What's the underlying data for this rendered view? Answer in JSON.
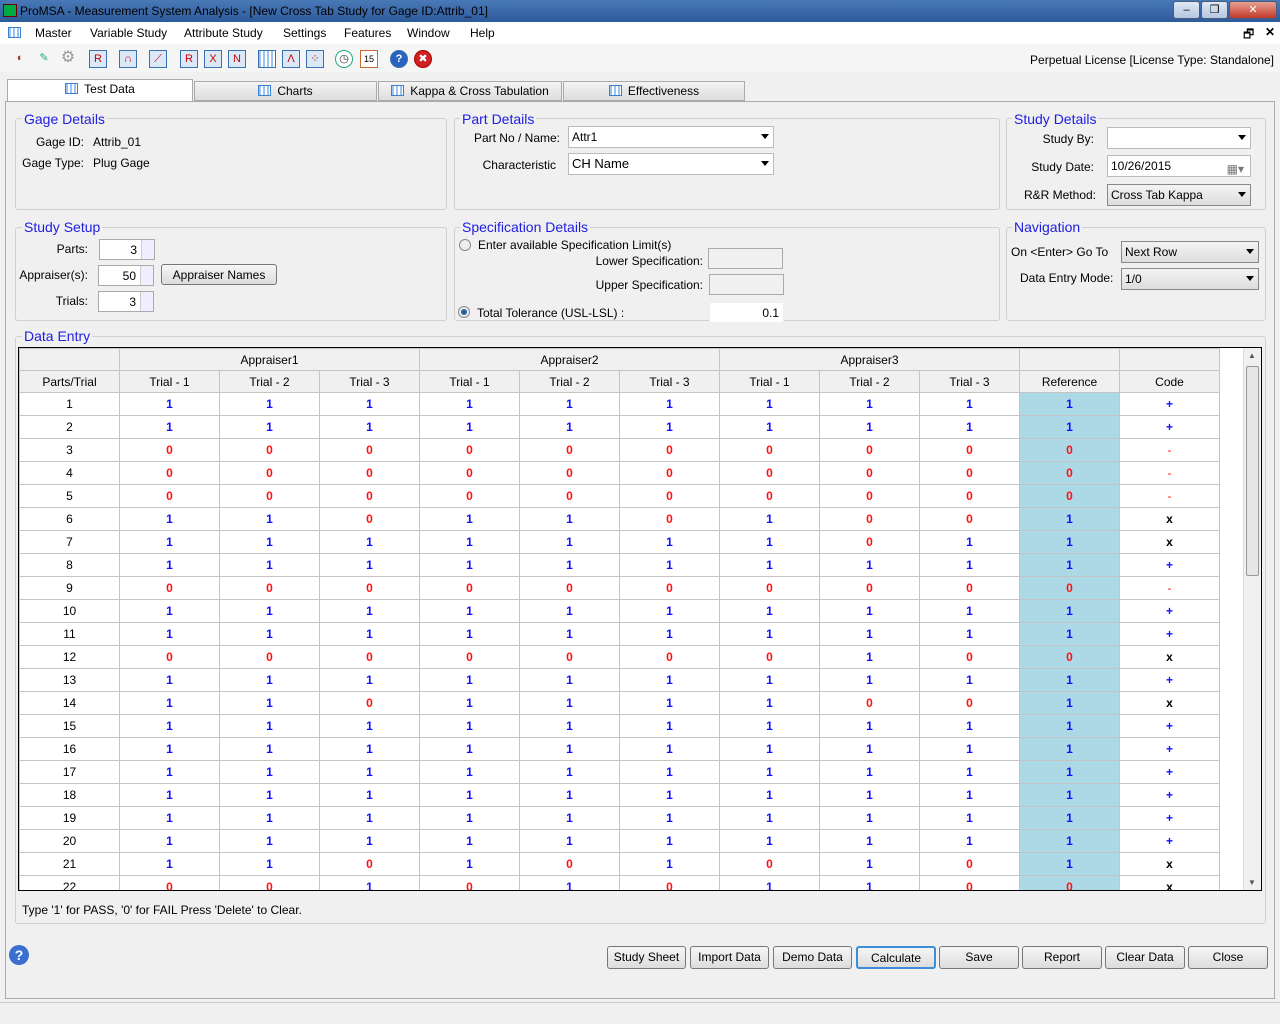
{
  "window": {
    "title": "ProMSA - Measurement System Analysis  - [New Cross Tab Study for Gage ID:Attrib_01]",
    "controls": [
      "minimize",
      "restore",
      "close"
    ]
  },
  "menu": [
    "Master",
    "Variable Study",
    "Attribute Study",
    "Settings",
    "Features",
    "Window",
    "Help"
  ],
  "toolbar": {
    "icons": [
      "paint-brush-icon",
      "pencil-icon",
      "gear-icon",
      "control-chart-r-icon",
      "normal-curve-icon",
      "linearity-icon",
      "chart-r-icon",
      "chart-x-icon",
      "chart-n-icon",
      "grid-icon",
      "distribution-icon",
      "scatter-icon",
      "clock-icon",
      "calendar-icon",
      "help-icon",
      "close-icon"
    ],
    "calendar_label": "15",
    "help_label": "?",
    "close_label": "✖"
  },
  "license": "Perpetual License [License Type: Standalone]",
  "tabs": [
    "Test Data",
    "Charts",
    "Kappa & Cross Tabulation",
    "Effectiveness"
  ],
  "gage": {
    "title": "Gage Details",
    "id_label": "Gage ID:",
    "id": "Attrib_01",
    "type_label": "Gage Type:",
    "type": "Plug Gage"
  },
  "part": {
    "title": "Part Details",
    "name_label": "Part No / Name:",
    "name": "Attr1",
    "char_label": "Characteristic",
    "char": "CH Name"
  },
  "study": {
    "title": "Study Details",
    "by_label": "Study By:",
    "by": "",
    "date_label": "Study Date:",
    "date": "10/26/2015",
    "method_label": "R&R Method:",
    "method": "Cross Tab Kappa"
  },
  "setup": {
    "title": "Study Setup",
    "parts_label": "Parts:",
    "parts": "3",
    "appr_label": "Appraiser(s):",
    "appr": "50",
    "trials_label": "Trials:",
    "trials": "3",
    "names_button": "Appraiser Names"
  },
  "spec": {
    "title": "Specification Details",
    "opt1": "Enter available Specification Limit(s)",
    "lower_label": "Lower Specification:",
    "lower": "",
    "upper_label": "Upper Specification:",
    "upper": "",
    "opt2": "Total Tolerance (USL-LSL) :",
    "tolerance": "0.1",
    "selected": "tolerance"
  },
  "nav": {
    "title": "Navigation",
    "enter_label": "On <Enter> Go To",
    "enter": "Next Row",
    "mode_label": "Data Entry Mode:",
    "mode": "1/0"
  },
  "data_entry": {
    "title": "Data Entry",
    "appraisers": [
      "Appraiser1",
      "Appraiser2",
      "Appraiser3"
    ],
    "columns": [
      "Parts/Trial",
      "Trial - 1",
      "Trial - 2",
      "Trial - 3",
      "Trial - 1",
      "Trial - 2",
      "Trial - 3",
      "Trial - 1",
      "Trial - 2",
      "Trial - 3",
      "Reference",
      "Code"
    ],
    "rows": [
      [
        "1",
        1,
        1,
        1,
        1,
        1,
        1,
        1,
        1,
        1,
        1,
        "+"
      ],
      [
        "2",
        1,
        1,
        1,
        1,
        1,
        1,
        1,
        1,
        1,
        1,
        "+"
      ],
      [
        "3",
        0,
        0,
        0,
        0,
        0,
        0,
        0,
        0,
        0,
        0,
        "-"
      ],
      [
        "4",
        0,
        0,
        0,
        0,
        0,
        0,
        0,
        0,
        0,
        0,
        "-"
      ],
      [
        "5",
        0,
        0,
        0,
        0,
        0,
        0,
        0,
        0,
        0,
        0,
        "-"
      ],
      [
        "6",
        1,
        1,
        0,
        1,
        1,
        0,
        1,
        0,
        0,
        1,
        "x"
      ],
      [
        "7",
        1,
        1,
        1,
        1,
        1,
        1,
        1,
        0,
        1,
        1,
        "x"
      ],
      [
        "8",
        1,
        1,
        1,
        1,
        1,
        1,
        1,
        1,
        1,
        1,
        "+"
      ],
      [
        "9",
        0,
        0,
        0,
        0,
        0,
        0,
        0,
        0,
        0,
        0,
        "-"
      ],
      [
        "10",
        1,
        1,
        1,
        1,
        1,
        1,
        1,
        1,
        1,
        1,
        "+"
      ],
      [
        "11",
        1,
        1,
        1,
        1,
        1,
        1,
        1,
        1,
        1,
        1,
        "+"
      ],
      [
        "12",
        0,
        0,
        0,
        0,
        0,
        0,
        0,
        1,
        0,
        0,
        "x"
      ],
      [
        "13",
        1,
        1,
        1,
        1,
        1,
        1,
        1,
        1,
        1,
        1,
        "+"
      ],
      [
        "14",
        1,
        1,
        0,
        1,
        1,
        1,
        1,
        0,
        0,
        1,
        "x"
      ],
      [
        "15",
        1,
        1,
        1,
        1,
        1,
        1,
        1,
        1,
        1,
        1,
        "+"
      ],
      [
        "16",
        1,
        1,
        1,
        1,
        1,
        1,
        1,
        1,
        1,
        1,
        "+"
      ],
      [
        "17",
        1,
        1,
        1,
        1,
        1,
        1,
        1,
        1,
        1,
        1,
        "+"
      ],
      [
        "18",
        1,
        1,
        1,
        1,
        1,
        1,
        1,
        1,
        1,
        1,
        "+"
      ],
      [
        "19",
        1,
        1,
        1,
        1,
        1,
        1,
        1,
        1,
        1,
        1,
        "+"
      ],
      [
        "20",
        1,
        1,
        1,
        1,
        1,
        1,
        1,
        1,
        1,
        1,
        "+"
      ],
      [
        "21",
        1,
        1,
        0,
        1,
        0,
        1,
        0,
        1,
        0,
        1,
        "x"
      ],
      [
        "22",
        0,
        0,
        1,
        0,
        1,
        0,
        1,
        1,
        0,
        0,
        "x"
      ]
    ]
  },
  "hint": "Type '1' for PASS, '0' for FAIL Press 'Delete' to Clear.",
  "buttons": [
    "Study Sheet",
    "Import Data",
    "Demo Data",
    "Calculate",
    "Save",
    "Report",
    "Clear Data",
    "Close"
  ],
  "colors": {
    "pass": "#1010ff",
    "fail": "#ff1010",
    "reference_bg": "#add8e6",
    "group_title": "#2020e0"
  }
}
